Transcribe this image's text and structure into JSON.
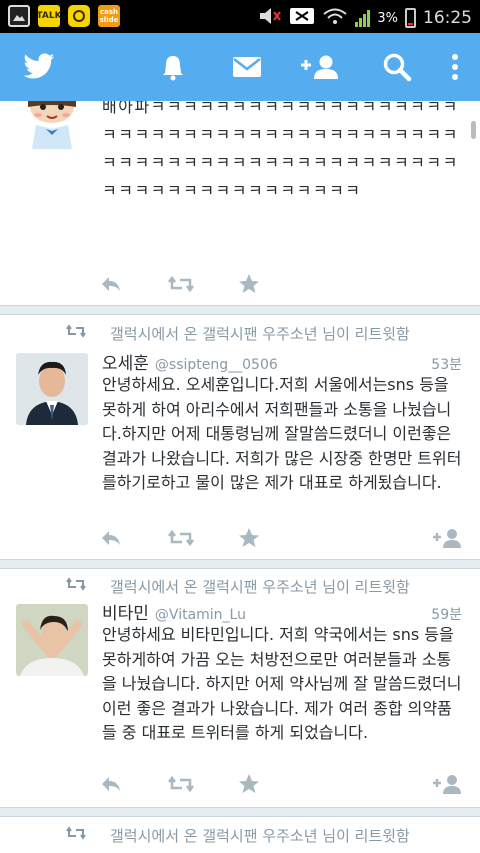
{
  "status_bar": {
    "battery": "3%",
    "time": "16:25",
    "icons": [
      "gallery-icon",
      "kakaotalk-icon",
      "kakaostory-icon",
      "cashslide-icon",
      "mute-icon",
      "no-signal-icon",
      "wifi-icon",
      "signal-icon",
      "battery-icon"
    ],
    "cashslide_label": "cash slide"
  },
  "app_bar": {
    "icons": [
      "twitter-bird-icon",
      "notifications-icon",
      "messages-icon",
      "add-follower-icon",
      "search-icon",
      "overflow-menu-icon"
    ],
    "accent": "#55acee"
  },
  "tweets": [
    {
      "body": "배아파ㅋㅋㅋㅋㅋㅋㅋㅋㅋㅋㅋㅋㅋㅋㅋㅋㅋㅋㅋㅋㅋㅋㅋㅋㅋㅋㅋㅋㅋㅋㅋㅋㅋㅋㅋㅋㅋㅋㅋㅋㅋㅋㅋㅋㅋㅋㅋㅋㅋㅋㅋㅋㅋㅋㅋㅋㅋㅋㅋㅋㅋㅋㅋㅋㅋㅋㅋㅋㅋㅋㅋㅋㅋㅋㅋㅋㅋㅋㅋ"
    },
    {
      "retweet_text": "갤럭시에서 온 갤럭시팬 우주소년  님이 리트윗함",
      "name": "오세훈",
      "handle": "@ssipteng__0506",
      "time": "53분",
      "body": "안녕하세요. 오세훈입니다.저희 서울에서는sns 등을 못하게 하여 아리수에서 저희팬들과 소통을 나눴습니다.하지만 어제 대통령님께 잘말씀드렸더니 이런좋은 결과가 나왔습니다. 저희가 많은 시장중 한명만 트위터를하기로하고 물이 많은 제가 대표로 하게됬습니다."
    },
    {
      "retweet_text": "갤럭시에서 온 갤럭시팬 우주소년  님이 리트윗함",
      "name": "비타민",
      "handle": "@Vitamin_Lu",
      "time": "59분",
      "body": "안녕하세요 비타민입니다. 저희 약국에서는 sns 등을 못하게하여 가끔 오는 처방전으로만 여러분들과 소통을 나눴습니다. 하지만 어제 약사님께 잘 말씀드렸더니 이런 좋은 결과가 나왔습니다. 제가 여러 종합 의약품들 중 대표로 트위터를 하게 되었습니다."
    },
    {
      "retweet_text": "갤럭시에서 온 갤럭시팬 우주소년  님이 리트윗함"
    }
  ]
}
